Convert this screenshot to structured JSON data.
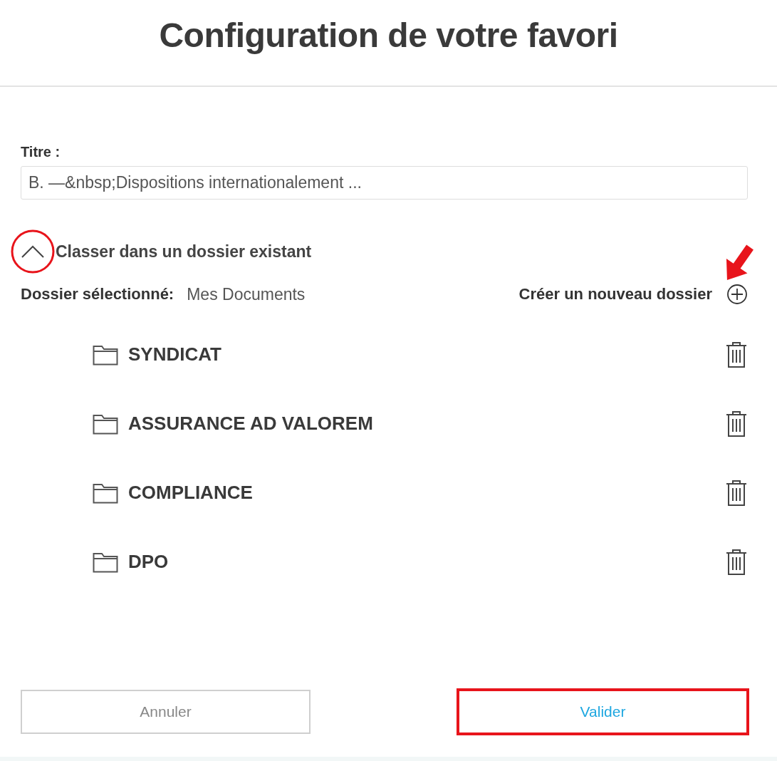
{
  "dialog": {
    "title": "Configuration de votre favori"
  },
  "title_field": {
    "label": "Titre :",
    "value": "B. —&nbsp;Dispositions internationalement ..."
  },
  "section": {
    "label": "Classer dans un dossier existant",
    "expanded": true
  },
  "selected_folder": {
    "label": "Dossier sélectionné:",
    "value": "Mes Documents"
  },
  "new_folder": {
    "label": "Créer un nouveau dossier"
  },
  "folders": [
    {
      "name": "SYNDICAT"
    },
    {
      "name": "ASSURANCE AD VALOREM"
    },
    {
      "name": "COMPLIANCE"
    },
    {
      "name": "DPO"
    }
  ],
  "buttons": [
    {
      "label": "Annuler",
      "kind": "cancel"
    },
    {
      "label": "Valider",
      "kind": "primary"
    }
  ],
  "annotations": [
    {
      "kind": "circle"
    },
    {
      "kind": "arrow"
    },
    {
      "kind": "frame"
    }
  ]
}
